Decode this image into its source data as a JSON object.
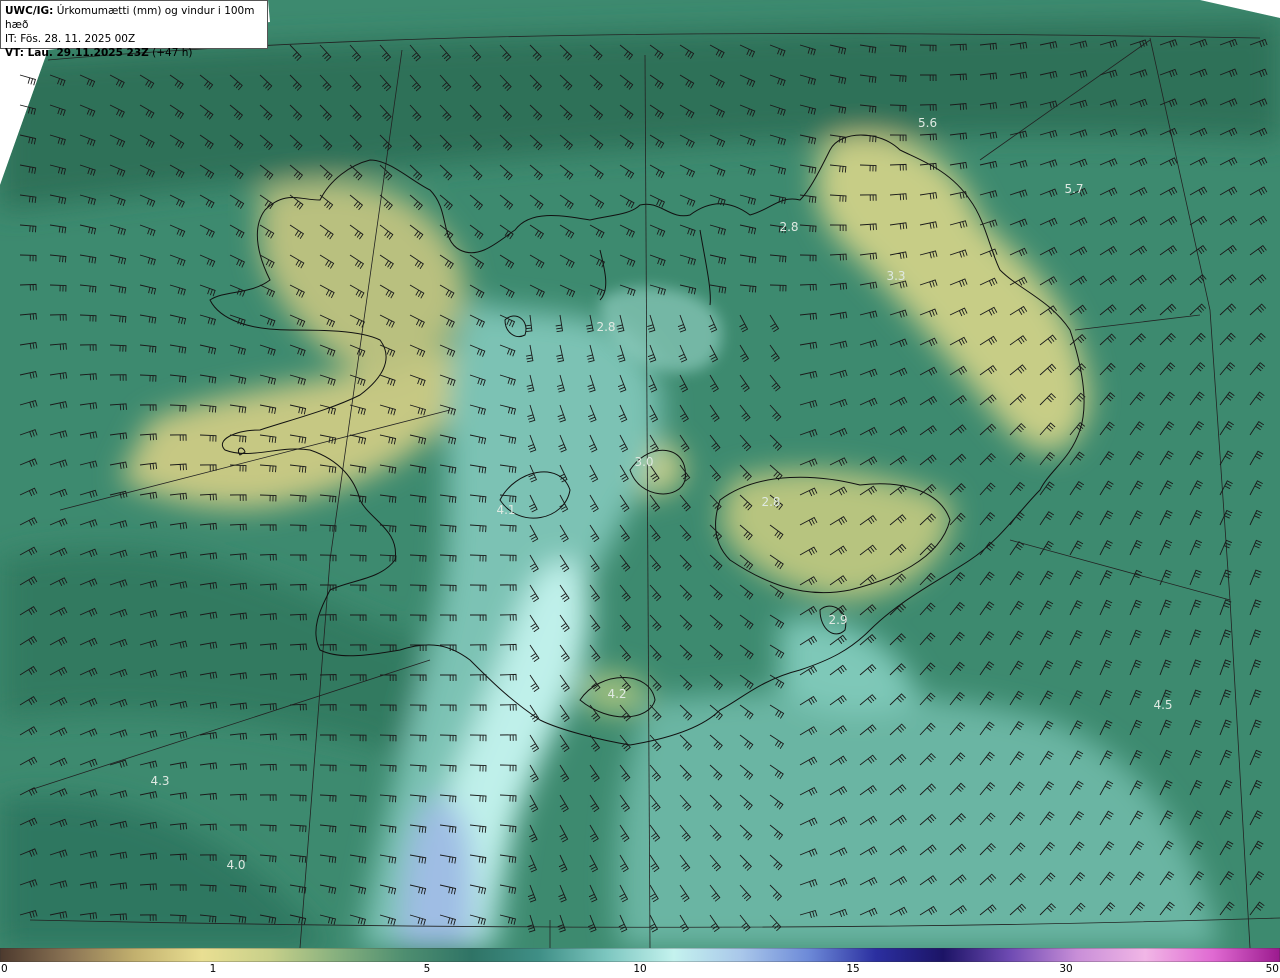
{
  "header": {
    "product": "UWC/IG:",
    "title": "Úrkomumætti (mm) og vindur i 100m hæð",
    "init_prefix": "IT:",
    "init_time": "Fös. 28. 11. 2025 00Z",
    "valid_prefix": "VT:",
    "valid_time": "Lau. 29.11.2025 23Z",
    "lead": "(+47 h)"
  },
  "colorbar": {
    "ticks": [
      "0",
      "1",
      "5",
      "10",
      "15",
      "30",
      "50"
    ],
    "colors": [
      "#4d3a2e",
      "#8a7354",
      "#c2b06e",
      "#e9df92",
      "#c8d08a",
      "#86b07e",
      "#4e8e70",
      "#2f7466",
      "#3f8f86",
      "#7cc6bf",
      "#c4f2ee",
      "#a9c7ea",
      "#6d8ad8",
      "#2b2fa0",
      "#1c1466",
      "#6f4bb3",
      "#c98fd8",
      "#f1b6e6",
      "#e06ad2",
      "#9b1a8e"
    ]
  },
  "labels": [
    {
      "name": "label-5-6",
      "text": "5.6"
    },
    {
      "name": "label-5-7",
      "text": "5.7"
    },
    {
      "name": "label-2-8-north",
      "text": "2.8"
    },
    {
      "name": "label-3-3",
      "text": "3.3"
    },
    {
      "name": "label-2-8-west",
      "text": "2.8"
    },
    {
      "name": "label-3-0",
      "text": "3.0"
    },
    {
      "name": "label-4-1",
      "text": "4.1"
    },
    {
      "name": "label-2-8-south",
      "text": "2.8"
    },
    {
      "name": "label-2-9",
      "text": "2.9"
    },
    {
      "name": "label-4-2",
      "text": "4.2"
    },
    {
      "name": "label-4-5",
      "text": "4.5"
    },
    {
      "name": "label-4-3",
      "text": "4.3"
    },
    {
      "name": "label-4-0",
      "text": "4.0"
    }
  ],
  "colors": {
    "background_sea": "#3f8b6e",
    "dark_green": "#2b6e55",
    "yellow_dry": "#d9d98c",
    "light_green": "#9cc98a",
    "cyan_wet": "#bdeee6",
    "blue_wet": "#9bb9e4",
    "barb": "#1a1a1a",
    "coast": "#111111"
  }
}
